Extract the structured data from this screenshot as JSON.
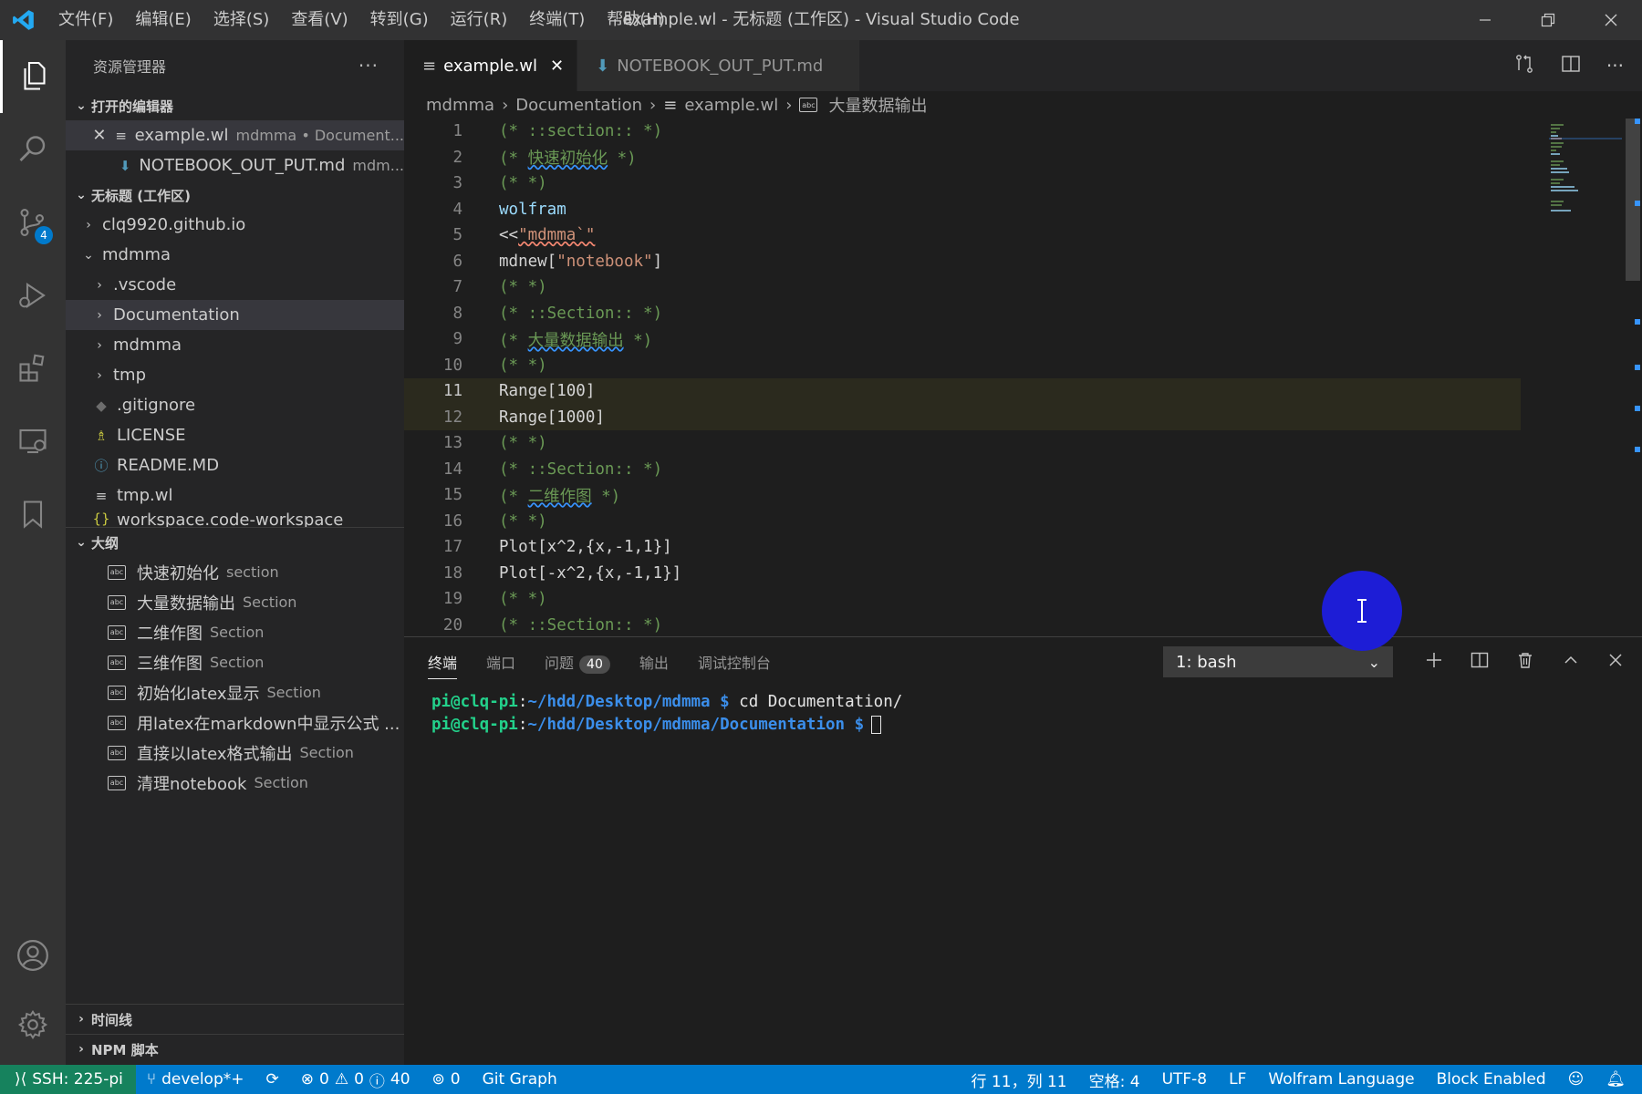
{
  "titlebar": {
    "menu": [
      "文件(F)",
      "编辑(E)",
      "选择(S)",
      "查看(V)",
      "转到(G)",
      "运行(R)",
      "终端(T)",
      "帮助(H)"
    ],
    "window_title": "example.wl - 无标题 (工作区) - Visual Studio Code"
  },
  "activitybar": {
    "scm_badge": "4"
  },
  "sidebar": {
    "title": "资源管理器",
    "open_editors": {
      "header": "打开的编辑器",
      "items": [
        {
          "name": "example.wl",
          "detail": "mdmma • Document..."
        },
        {
          "name": "NOTEBOOK_OUT_PUT.md",
          "detail": "mdm..."
        }
      ]
    },
    "workspace": {
      "header": "无标题 (工作区)",
      "items": [
        "clq9920.github.io",
        "mdmma",
        ".vscode",
        "Documentation",
        "mdmma",
        "tmp",
        ".gitignore",
        "LICENSE",
        "README.MD",
        "tmp.wl",
        "workspace.code-workspace"
      ]
    },
    "outline": {
      "header": "大纲",
      "items": [
        {
          "name": "快速初始化",
          "kind": "section"
        },
        {
          "name": "大量数据输出",
          "kind": "Section"
        },
        {
          "name": "二维作图",
          "kind": "Section"
        },
        {
          "name": "三维作图",
          "kind": "Section"
        },
        {
          "name": "初始化latex显示",
          "kind": "Section"
        },
        {
          "name": "用latex在markdown中显示公式 ...",
          "kind": ""
        },
        {
          "name": "直接以latex格式输出",
          "kind": "Section"
        },
        {
          "name": "清理notebook",
          "kind": "Section"
        }
      ]
    },
    "timeline_header": "时间线",
    "npm_header": "NPM 脚本"
  },
  "tabs": [
    {
      "label": "example.wl"
    },
    {
      "label": "NOTEBOOK_OUT_PUT.md"
    }
  ],
  "breadcrumb": [
    "mdmma",
    "Documentation",
    "example.wl",
    "大量数据输出"
  ],
  "code": {
    "line_numbers": [
      "1",
      "2",
      "3",
      "4",
      "5",
      "6",
      "7",
      "8",
      "9",
      "10",
      "11",
      "12",
      "13",
      "14",
      "15",
      "16",
      "17",
      "18",
      "19",
      "20"
    ],
    "l1": "(* ::section:: *)",
    "l2a": "(* ",
    "l2b": "快速初始化",
    "l2c": " *)",
    "l3": "(* *)",
    "l4": "wolfram",
    "l5a": "<<",
    "l5b": "\"mdmma`\"",
    "l6a": "mdnew[",
    "l6b": "\"notebook\"",
    "l6c": "]",
    "l7": "(* *)",
    "l8": "(* ::Section:: *)",
    "l9a": "(* ",
    "l9b": "大量数据输出",
    "l9c": " *)",
    "l10": "(* *)",
    "l11": "Range[100]",
    "l12": "Range[1000]",
    "l13": "(* *)",
    "l14": "(* ::Section:: *)",
    "l15a": "(* ",
    "l15b": "二维作图",
    "l15c": " *)",
    "l16": "(* *)",
    "l17": "Plot[x^2,{x,-1,1}]",
    "l18": "Plot[-x^2,{x,-1,1}]",
    "l19": "(* *)",
    "l20": "(* ::Section:: *)"
  },
  "panel": {
    "tabs": [
      "终端",
      "端口",
      "问题",
      "输出",
      "调试控制台"
    ],
    "problems_count": "40",
    "terminal_select": "1: bash",
    "lines": [
      {
        "user": "pi@clq-pi",
        "sep": ":",
        "path": "~/hdd/Desktop/mdmma $",
        "cmd": " cd Documentation/"
      },
      {
        "user": "pi@clq-pi",
        "sep": ":",
        "path": "~/hdd/Desktop/mdmma/Documentation $",
        "cmd": " "
      }
    ]
  },
  "statusbar": {
    "remote": "SSH: 225-pi",
    "branch": "develop*+",
    "errors": "0",
    "warnings": "0",
    "infos": "40",
    "ports": "0",
    "git_graph": "Git Graph",
    "position": "行 11，列 11",
    "spaces": "空格: 4",
    "encoding": "UTF-8",
    "eol": "LF",
    "language": "Wolfram Language",
    "block": "Block Enabled"
  },
  "colors": {
    "accent": "#007acc",
    "remote": "#16825d",
    "cursor_dot": "#1d1dd6"
  }
}
